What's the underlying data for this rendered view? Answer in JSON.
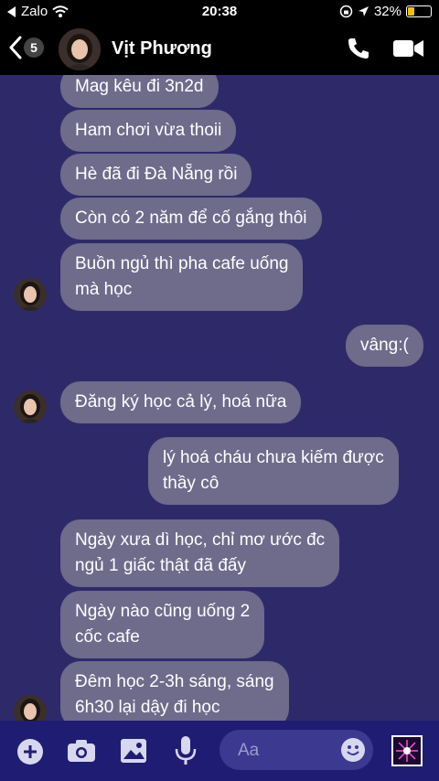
{
  "status_bar": {
    "back_app": "Zalo",
    "time": "20:38",
    "battery_percent": "32%",
    "battery_level": 0.32,
    "battery_color": "#f2c200"
  },
  "header": {
    "back_count": "5",
    "contact_name": "Vịt Phương",
    "icons": [
      "chevron-left-icon",
      "phone-icon",
      "video-camera-icon"
    ]
  },
  "messages": [
    {
      "side": "received",
      "text": "Mag kêu đi 3n2d"
    },
    {
      "side": "received",
      "text": "Ham chơi vừa thoii"
    },
    {
      "side": "received",
      "text": "Hè đã đi Đà Nẵng rồi"
    },
    {
      "side": "received",
      "text": "Còn có 2 năm để cố gắng thôi"
    },
    {
      "side": "received",
      "text": "Buồn ngủ thì pha cafe uống\nmà học"
    },
    {
      "side": "sent",
      "text": "vâng:("
    },
    {
      "side": "received",
      "text": "Đăng ký học cả lý, hoá nữa"
    },
    {
      "side": "sent",
      "text": "lý hoá cháu chưa kiếm được\nthầy cô"
    },
    {
      "side": "received",
      "text": "Ngày xưa dì học, chỉ mơ ước đc\nngủ 1 giấc thật đã đấy"
    },
    {
      "side": "received",
      "text": "Ngày nào cũng uống 2\ncốc cafe"
    },
    {
      "side": "received",
      "text": "Đêm học 2-3h sáng, sáng\n6h30 lại dậy đi học"
    }
  ],
  "composer": {
    "placeholder": "Aa",
    "icons": [
      "plus-icon",
      "camera-icon",
      "image-icon",
      "microphone-icon",
      "emoji-icon",
      "sticker-icon"
    ]
  },
  "colors": {
    "background": "#2e2a6a",
    "bubble": "#6e6b8b",
    "bar": "#000000",
    "composer": "#1f1d73"
  }
}
